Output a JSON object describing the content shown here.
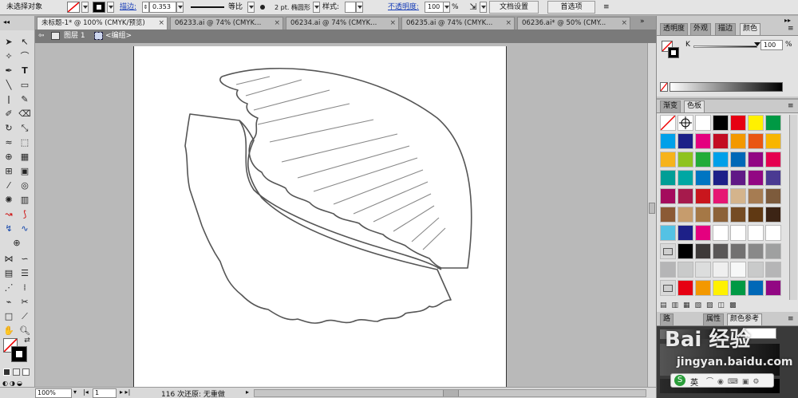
{
  "control_bar": {
    "selection_status": "未选择对象",
    "stroke_label": "描边:",
    "stroke_weight": "0.353",
    "profile_label": "等比",
    "brush": "2 pt. 椭圆形",
    "style_label": "样式:",
    "opacity_label": "不透明度:",
    "opacity_value": "100",
    "opacity_unit": "%",
    "doc_setup_button": "文档设置",
    "preferences_button": "首选项"
  },
  "doc_tabs": [
    {
      "label": "未标题-1* @ 100% (CMYK/预览)"
    },
    {
      "label": "06233.ai @ 74% (CMYK..."
    },
    {
      "label": "06234.ai @ 74% (CMYK..."
    },
    {
      "label": "06235.ai @ 74% (CMYK..."
    },
    {
      "label": "06236.ai* @ 50% (CMY..."
    }
  ],
  "breadcrumb": {
    "layer": "图层 1",
    "group": "<编组>"
  },
  "status_bar": {
    "zoom": "100%",
    "page": "1",
    "message": "116 次还原: 无重做"
  },
  "panels": {
    "top_tabs": [
      "透明度",
      "外观",
      "描边",
      "颜色"
    ],
    "color": {
      "k_label": "K",
      "k_value": "100",
      "k_unit": "%"
    },
    "swatch_tabs": [
      "渐变",
      "色板"
    ],
    "bottom_tabs": [
      "路",
      "属性",
      "颜色参考"
    ]
  },
  "swatches": {
    "colors": [
      [
        "#ffffff",
        "#ffffff",
        "#ffffff",
        "#000000",
        "#e60012",
        "#fff100",
        "#009944"
      ],
      [
        "#00a0e9",
        "#1d2088",
        "#e4007f",
        "#c30d23",
        "#f39800",
        "#e95513",
        "#f8b500"
      ],
      [
        "#f6b31b",
        "#8fc31f",
        "#22ac38",
        "#00a0e9",
        "#0068b7",
        "#920783",
        "#e5004f"
      ],
      [
        "#009e96",
        "#00a7a3",
        "#0075c2",
        "#1d2088",
        "#601986",
        "#920783",
        "#4a3a92"
      ],
      [
        "#a40b5d",
        "#a61a4c",
        "#c9161d",
        "#e61673",
        "#d4b48c",
        "#a67c52",
        "#7d5b3c"
      ],
      [
        "#8b5a36",
        "#c69c6d",
        "#a57846",
        "#8c6239",
        "#754c24",
        "#603913",
        "#3c2415"
      ],
      [
        "#54c2e4",
        "#1d2088",
        "#e4007f",
        "#ffffff",
        "#ffffff",
        "#ffffff",
        "#ffffff"
      ],
      [
        "#ffffff",
        "#000000",
        "#3e3a39",
        "#595757",
        "#727171",
        "#898989",
        "#9fa0a0"
      ],
      [
        "#b5b5b6",
        "#c9caca",
        "#dcdddd",
        "#efefef",
        "#f7f8f8",
        "#c9caca",
        "#b5b5b6"
      ],
      [
        "#ffffff",
        "#e60012",
        "#f39800",
        "#fff100",
        "#009944",
        "#0068b7",
        "#920783"
      ]
    ]
  },
  "watermark": {
    "brand": "Bai 经验",
    "url": "jingyan.baidu.com"
  },
  "ime": {
    "label": "英"
  }
}
